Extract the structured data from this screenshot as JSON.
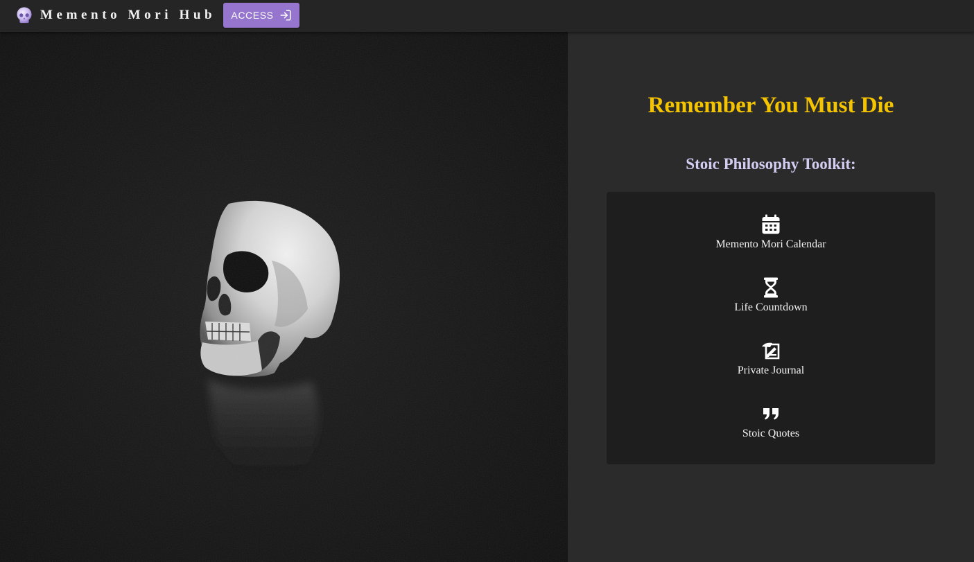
{
  "header": {
    "brand_title": "Memento Mori Hub",
    "access_label": "ACCESS",
    "logo_icon": "skull-icon",
    "access_icon": "login-icon"
  },
  "hero": {
    "image": "skull-photo"
  },
  "panel": {
    "heading": "Remember You Must Die",
    "subheading": "Stoic Philosophy Toolkit:",
    "tools": [
      {
        "label": "Memento Mori Calendar",
        "icon": "calendar-icon"
      },
      {
        "label": "Life Countdown",
        "icon": "hourglass-icon"
      },
      {
        "label": "Private Journal",
        "icon": "journal-icon"
      },
      {
        "label": "Stoic Quotes",
        "icon": "quote-icon"
      }
    ]
  },
  "colors": {
    "topbar": "#252525",
    "accent_button": "#9575cd",
    "heading": "#f5c400",
    "subheading": "#d4cdf2",
    "panel_bg": "#2b2b2b",
    "card_bg": "#1e1e1e"
  }
}
